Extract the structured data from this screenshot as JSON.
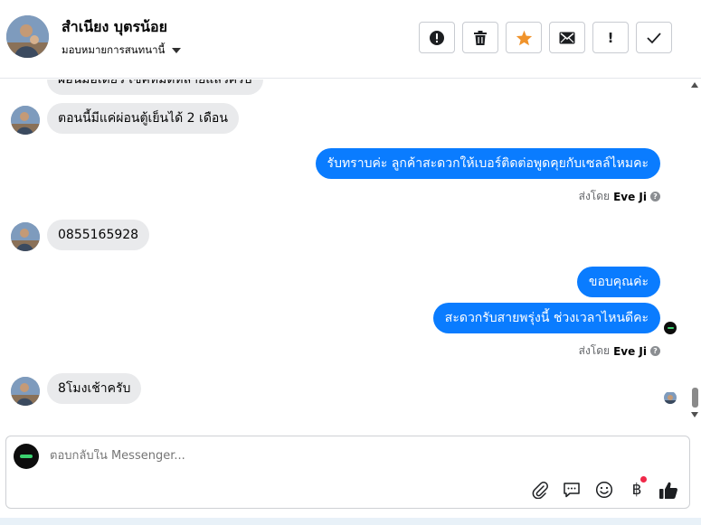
{
  "header": {
    "contact_name": "สำเนียง บุตรน้อย",
    "assign_label": "มอบหมายการสนทนานี้",
    "buttons": [
      {
        "name": "report",
        "icon": "alert-circle-icon"
      },
      {
        "name": "delete",
        "icon": "trash-icon"
      },
      {
        "name": "star",
        "icon": "star-icon",
        "color": "#f0932b"
      },
      {
        "name": "mark-unread",
        "icon": "envelope-icon"
      },
      {
        "name": "follow-up",
        "icon": "exclamation-icon",
        "text": "!"
      },
      {
        "name": "done",
        "icon": "check-icon"
      }
    ]
  },
  "messages": [
    {
      "direction": "in",
      "text": "ผ่อนมือเดียว เซ็คหมดหลายแล้วครับ"
    },
    {
      "direction": "in",
      "text": "ตอนนี้มีแค่ผ่อนตู้เย็นได้ 2 เดือน"
    },
    {
      "direction": "out",
      "text": "รับทราบค่ะ ลูกค้าสะดวกให้เบอร์ติดต่อพูดคุยกับเซลล์ไหมคะ"
    },
    {
      "direction": "in",
      "text": "0855165928"
    },
    {
      "direction": "out",
      "text": "ขอบคุณค่ะ"
    },
    {
      "direction": "out",
      "text": "สะดวกรับสายพรุ่งนี้ ช่วงเวลาไหนดีคะ"
    },
    {
      "direction": "in",
      "text": "8โมงเช้าครับ"
    }
  ],
  "sent_by": {
    "prefix": "ส่งโดย",
    "name": "Eve Ji",
    "help": "?"
  },
  "composer": {
    "placeholder": "ตอบกลับใน Messenger...",
    "tools": [
      "paperclip-icon",
      "saved-reply-icon",
      "emoji-icon",
      "baht-payment-icon",
      "thumbs-up-icon"
    ],
    "baht_symbol": "฿",
    "notification_dot_color": "#f02849"
  },
  "colors": {
    "accent": "#0a7cff",
    "incoming_bubble": "#e9eaec"
  }
}
